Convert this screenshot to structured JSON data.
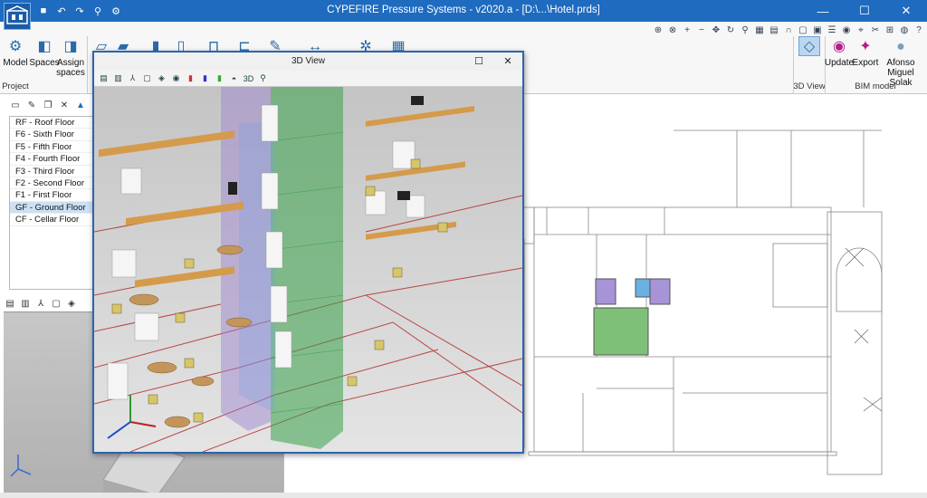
{
  "app": {
    "title": "CYPEFIRE Pressure Systems - v2020.a - [D:\\...\\Hotel.prds]",
    "logo_icon": "cype-building-logo",
    "brand_color": "#1e6bbf"
  },
  "quick_access": {
    "icons": [
      "save-icon",
      "undo-icon",
      "redo-icon",
      "find-icon",
      "settings-icon"
    ]
  },
  "window_controls": {
    "minimize": "—",
    "maximize": "☐",
    "close": "✕"
  },
  "ribbon": {
    "model_label": "Model",
    "spaces_label": "Spaces",
    "assign_spaces_label": "Assign spaces",
    "project_group": "Project",
    "view3d_group": "3D View",
    "bim_group": "BIM model",
    "update_label": "Update",
    "export_label": "Export",
    "user_name": "Afonso Miguel Solak"
  },
  "floors": [
    {
      "label": "RF - Roof Floor"
    },
    {
      "label": "F6 - Sixth Floor"
    },
    {
      "label": "F5 - Fifth Floor"
    },
    {
      "label": "F4 - Fourth Floor"
    },
    {
      "label": "F3 - Third Floor"
    },
    {
      "label": "F2 - Second Floor"
    },
    {
      "label": "F1 - First Floor"
    },
    {
      "label": "GF - Ground Floor",
      "selected": true
    },
    {
      "label": "CF - Cellar Floor"
    }
  ],
  "view3d": {
    "title": "3D View",
    "minimize": "—",
    "maximize": "☐",
    "close": "✕"
  },
  "colors": {
    "accent": "#1e6bbf",
    "selection": "#cde0f4",
    "green_volume": "#3aa34a",
    "purple_volume": "#9b7fd0",
    "pipe_red": "#b02020"
  }
}
